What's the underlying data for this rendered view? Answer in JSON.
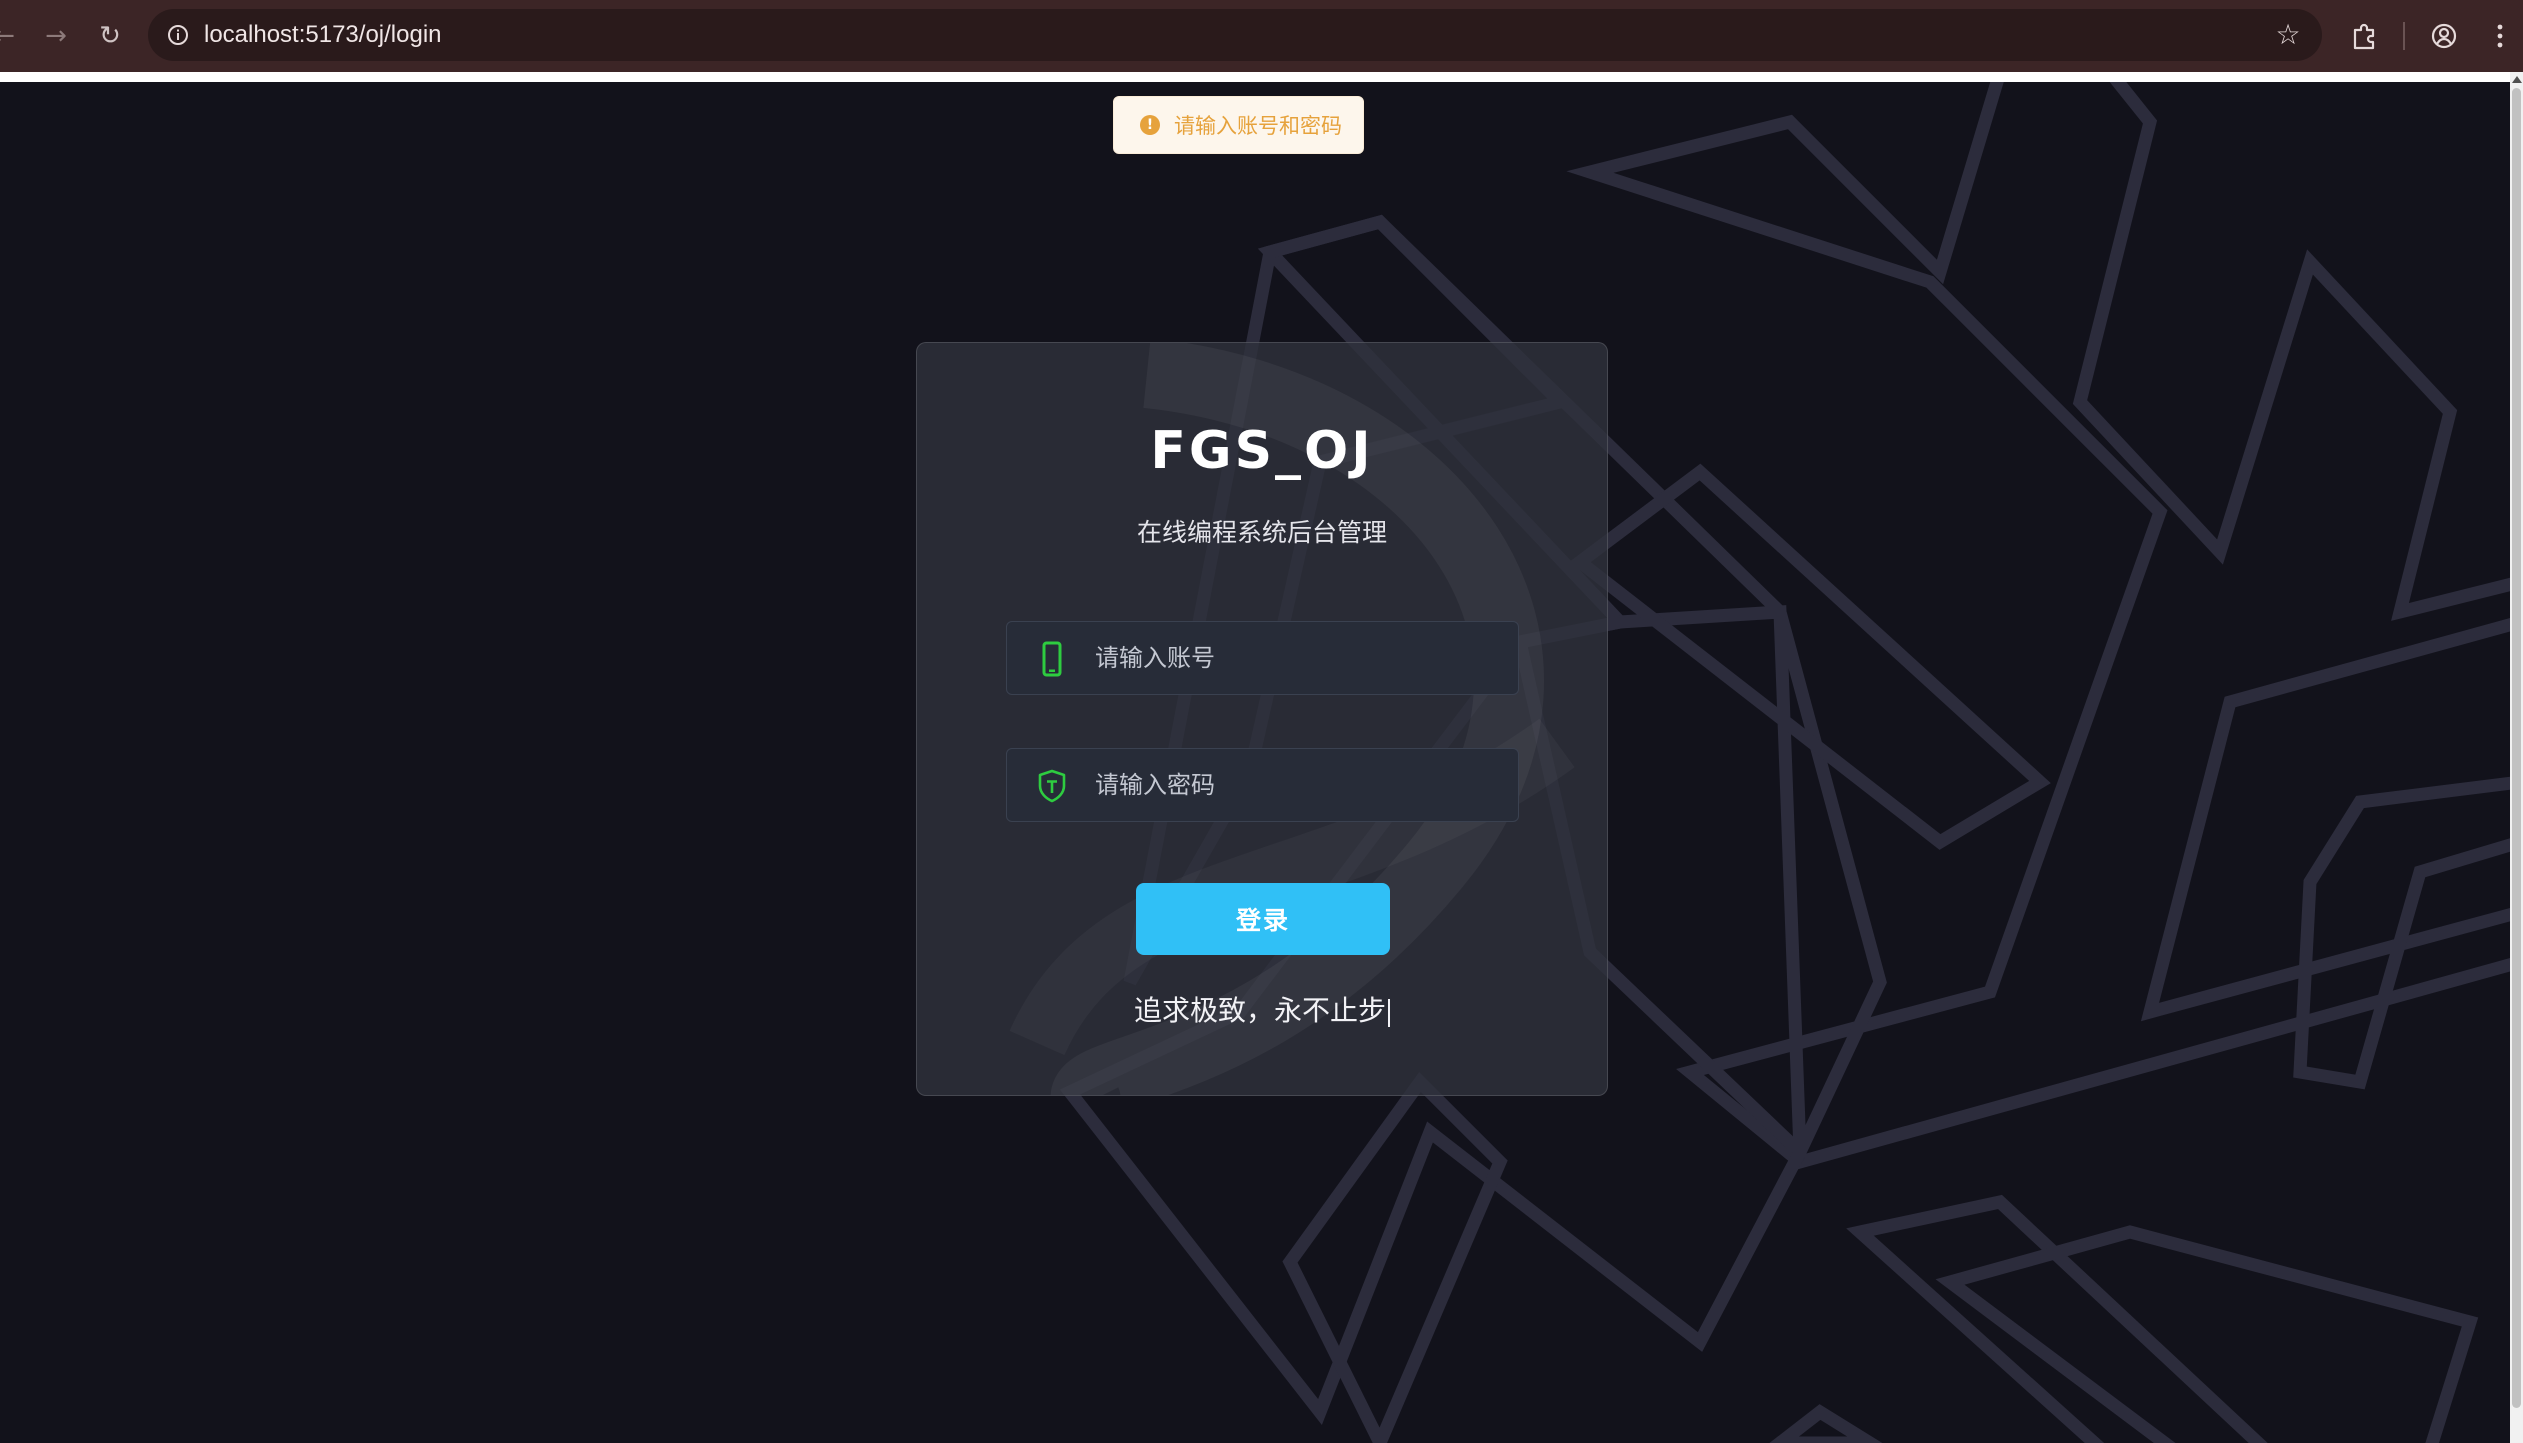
{
  "browser": {
    "url": "localhost:5173/oj/login",
    "icons": {
      "back": "arrow-left",
      "forward": "arrow-right",
      "reload": "reload",
      "site_info": "info-circle",
      "bookmark": "star-outline",
      "extensions": "puzzle",
      "profile": "account-circle",
      "menu": "kebab-vertical"
    }
  },
  "toast": {
    "message": "请输入账号和密码",
    "icon": "warning-circle",
    "color": "#e6a23c"
  },
  "login": {
    "title": "FGS_OJ",
    "subtitle": "在线编程系统后台管理",
    "account_placeholder": "请输入账号",
    "account_icon": "phone-icon",
    "password_placeholder": "请输入密码",
    "password_icon": "shield-icon",
    "submit_label": "登录",
    "motto": "追求极致，永不止步",
    "accent_color": "#30c0f6",
    "icon_color": "#2ecc40"
  }
}
